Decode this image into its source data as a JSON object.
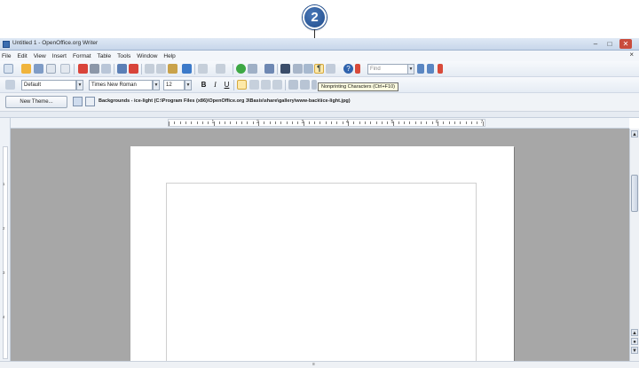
{
  "callout": {
    "number": "2"
  },
  "window": {
    "title": "Untitled 1 - OpenOffice.org Writer"
  },
  "menu": [
    "File",
    "Edit",
    "View",
    "Insert",
    "Format",
    "Table",
    "Tools",
    "Window",
    "Help"
  ],
  "formatting": {
    "style": "Default",
    "font": "Times New Roman",
    "size": "12",
    "bold": "B",
    "italic": "I",
    "underline": "U"
  },
  "find": {
    "placeholder": "Find"
  },
  "tooltip": "Nonprinting Characters (Ctrl+F10)",
  "gallery": {
    "new_theme_label": "New Theme...",
    "path": "Backgrounds - ice-light (C:\\Program Files (x86)\\OpenOffice.org 3\\Basis\\share\\gallery\\www-back\\ice-light.jpg)"
  },
  "ruler": {
    "h_numbers": [
      "1",
      "2",
      "3",
      "4",
      "5",
      "6",
      "7"
    ],
    "v_numbers": [
      "1",
      "2",
      "3",
      "4"
    ]
  },
  "colors": {
    "callout": "#1f4c8c",
    "tooltip_bg": "#ffffe1",
    "doc_background": "#a7a7a7",
    "toolbar_highlight": "#fde9a9"
  }
}
